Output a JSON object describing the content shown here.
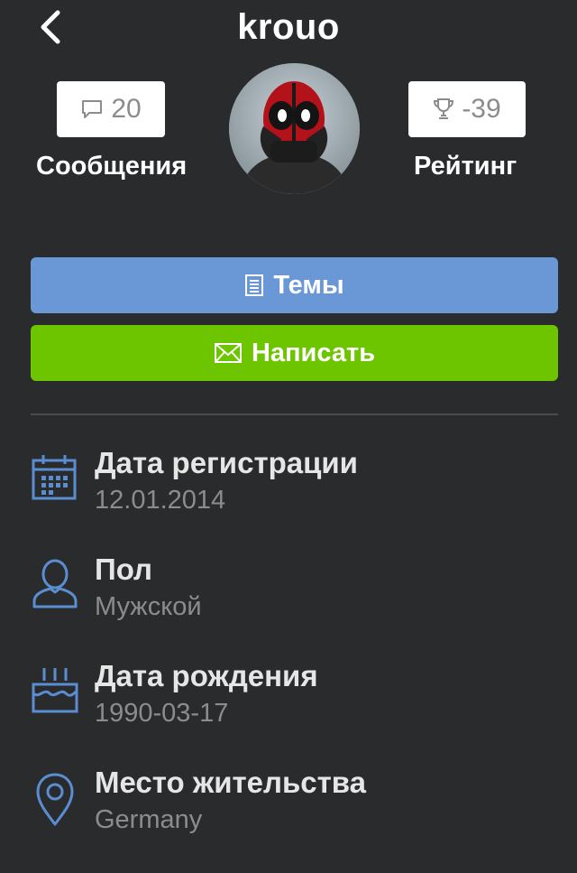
{
  "header": {
    "title": "krouo",
    "back_icon": "chevron-left-icon"
  },
  "stats": {
    "messages": {
      "count": "20",
      "label": "Сообщения",
      "icon": "chat-bubble-icon"
    },
    "rating": {
      "value": "-39",
      "label": "Рейтинг",
      "icon": "trophy-icon"
    }
  },
  "avatar": {
    "icon": "user-avatar"
  },
  "actions": {
    "topics_label": "Темы",
    "topics_icon": "document-list-icon",
    "write_label": "Написать",
    "write_icon": "envelope-icon"
  },
  "info": [
    {
      "label": "Дата регистрации",
      "value": "12.01.2014",
      "icon": "calendar-icon"
    },
    {
      "label": "Пол",
      "value": "Мужской",
      "icon": "person-icon"
    },
    {
      "label": "Дата рождения",
      "value": "1990-03-17",
      "icon": "birthday-cake-icon"
    },
    {
      "label": "Место жительства",
      "value": "Germany",
      "icon": "location-pin-icon"
    }
  ],
  "colors": {
    "background": "#2a2b2d",
    "topics_button": "#6a97d6",
    "write_button": "#6dc500",
    "icon_blue": "#5b8dd1"
  }
}
